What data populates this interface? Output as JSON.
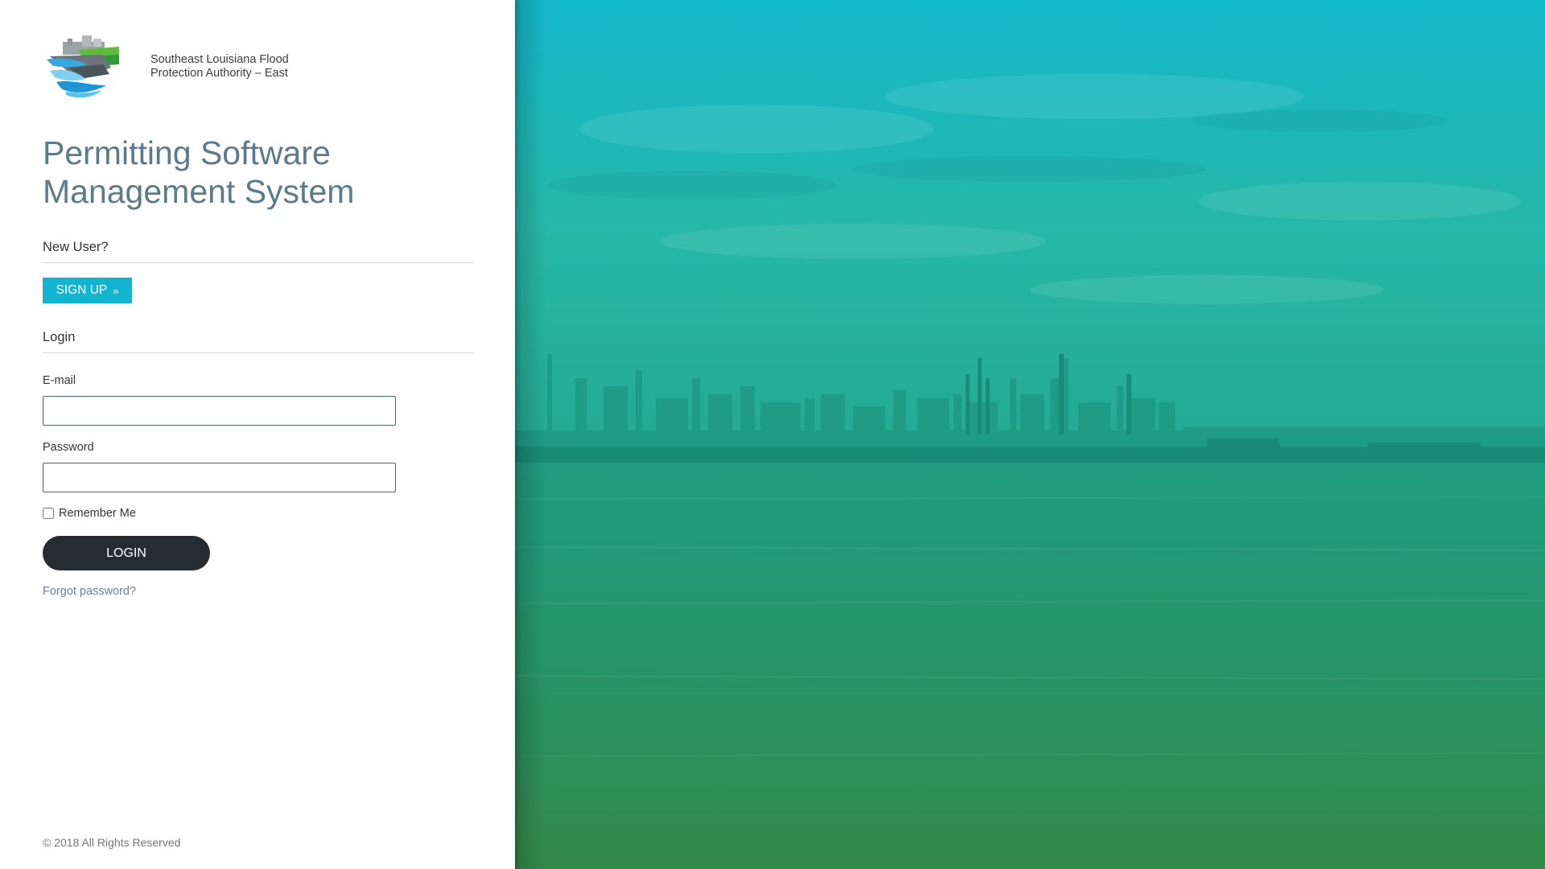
{
  "brand": {
    "logo_icon": "flood-protection-logo",
    "name_line1": "Southeast Louisiana Flood",
    "name_line2": "Protection Authority – East"
  },
  "app_title": {
    "line1": "Permitting Software",
    "line2": "Management System"
  },
  "signup": {
    "heading": "New User?",
    "button_label": "SIGN UP",
    "button_icon": "double-chevron-right-icon"
  },
  "login": {
    "heading": "Login",
    "email_label": "E-mail",
    "email_value": "",
    "password_label": "Password",
    "password_value": "",
    "remember_label": "Remember Me",
    "remember_checked": false,
    "button_label": "LOGIN",
    "forgot_label": "Forgot password?"
  },
  "footer": {
    "copyright": "© 2018 All Rights Reserved"
  },
  "colors": {
    "title": "#5b7a8c",
    "signup_button": "#12b5cf",
    "login_button": "#262d32",
    "hero_top": "#14b9cc",
    "hero_middle": "#22a58a",
    "hero_bottom": "#338a4b"
  },
  "hero": {
    "image": "industrial-skyline-over-river"
  }
}
